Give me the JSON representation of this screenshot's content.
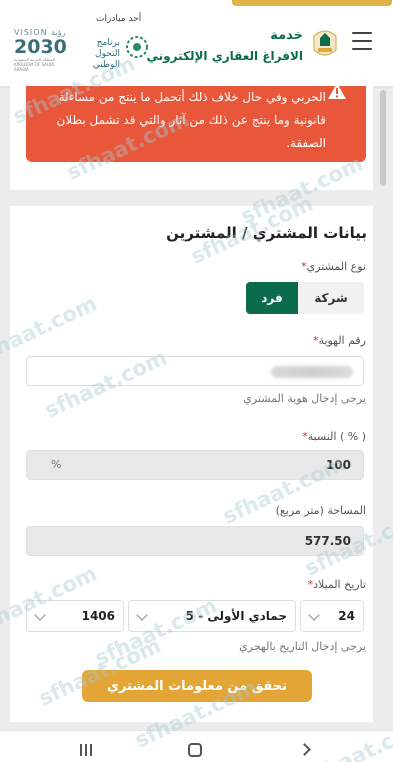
{
  "header": {
    "service_line1": "خدمة",
    "service_line2": "الافراغ العقاري الإلكتروني",
    "initiatives_label": "أحد مبادرات",
    "ntp_label": "برنامج التحول الوطني",
    "vision_small": "VISION رؤية",
    "vision_big": "2030",
    "vision_sub": "المملكة العربية السعودية KINGDOM OF SAUDI ARABIA"
  },
  "warning": {
    "text": "الحربي وفي حال خلاف ذلك أتحمل ما ينتج من مساءلة قانونية وما ينتج عن ذلك من آثار والتي قد تشمل بطلان الصفقة."
  },
  "form": {
    "title": "بيانات المشتري / المشترين",
    "buyer_type_label": "نوع المشتري",
    "buyer_type_options": [
      "شركة",
      "فرد"
    ],
    "buyer_type_selected": "فرد",
    "id_label": "رقم الهوية",
    "id_helper": "يرجى إدخال هوية المشتري",
    "percent_label": "النسبة ( % )",
    "percent_value": "100",
    "percent_unit": "%",
    "area_label": "المساحة (متر مربع)",
    "area_value": "577.50",
    "dob_label": "تاريخ الميلاد",
    "dob_day": "24",
    "dob_month": "5 - جمادي الأولى",
    "dob_year": "1406",
    "dob_helper": "يرجى إدخال التاريخ بالهجري",
    "verify_button": "تحقق من معلومات المشتري"
  },
  "watermark": "sfhaat.com",
  "colors": {
    "primary_green": "#0b6b4c",
    "warning_red": "#e8573a",
    "accent_gold": "#e3a536"
  }
}
